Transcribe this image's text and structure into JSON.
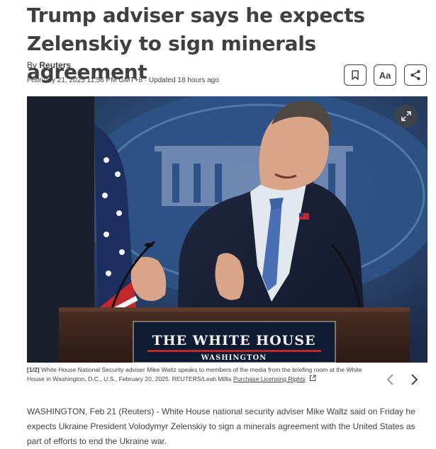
{
  "article": {
    "headline": "Trump adviser says he expects Zelenskiy to sign minerals agreement",
    "byline_prefix": "By",
    "author": "Reuters",
    "dateline": "February 21, 2025 11:56 PM GMT+8 · Updated 18 hours ago",
    "body_first_paragraph": "WASHINGTON, Feb 21 (Reuters) - White House national security adviser Mike Waltz said on Friday he expects Ukraine President Volodymyr Zelenskiy to sign a minerals agreement with the United States as part of efforts to end the Ukraine war."
  },
  "toolbar": {
    "bookmark_icon": "bookmark-icon",
    "text_size_label": "Aa",
    "share_icon": "share-icon"
  },
  "photo": {
    "podium_title": "THE WHITE HOUSE",
    "podium_subtitle": "WASHINGTON",
    "expand_icon": "expand-icon"
  },
  "caption": {
    "index": "[1/2]",
    "text": " White House National Security adviser Mike Waltz speaks to members of the media from the briefing room at the White House in Washington, D.C., U.S., February 20, 2025. REUTERS/Leah Millis ",
    "license_link": "Purchase Licensing Rights",
    "external_icon": "external-link-icon"
  },
  "gallery_nav": {
    "prev_icon": "chevron-left-icon",
    "next_icon": "chevron-right-icon"
  },
  "colors": {
    "text": "#404040",
    "podium_red": "#c0262c",
    "wall_blue": "#3a5f93"
  }
}
